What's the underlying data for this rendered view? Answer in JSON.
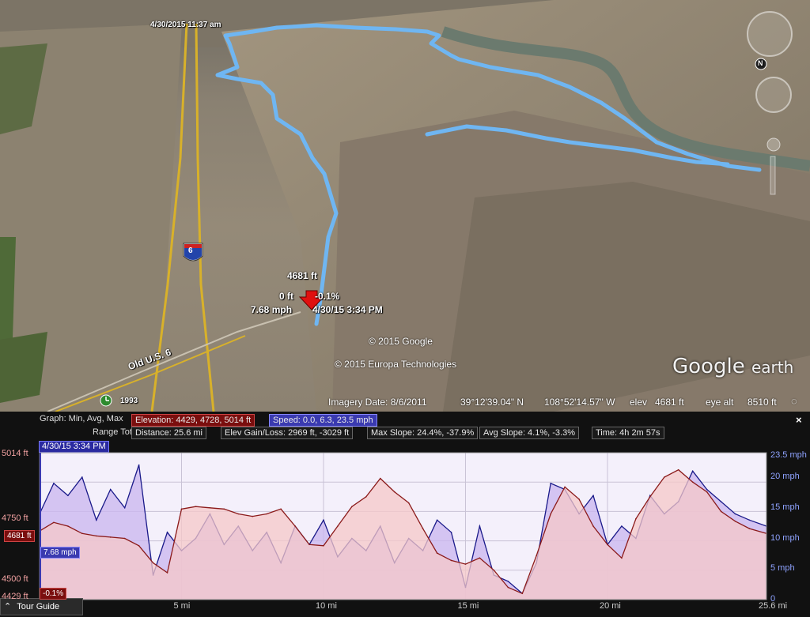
{
  "map": {
    "start_label": "4/30/2015  11:37 am",
    "highway_shield": "6",
    "road_label": "Old U.S. 6",
    "year_label": "1993",
    "cursor": {
      "elevation": "4681 ft",
      "dist": "0 ft",
      "slope": "-0.1%",
      "speed": "7.68 mph",
      "time": "4/30/15 3:34 PM"
    },
    "copyright_google": "© 2015 Google",
    "copyright_europa": "© 2015 Europa Technologies",
    "logo_text": "Google",
    "logo_sub": "earth",
    "compass_label": "N",
    "colors": {
      "track": "#6fb6f2",
      "highway": "#d8b12a",
      "cursor_arrow": "#e01010"
    }
  },
  "status": {
    "imagery_date": "Imagery Date: 8/6/2011",
    "lat": "39°12'39.04\" N",
    "lon": "108°52'14.57\" W",
    "elev_label": "elev",
    "elev": "4681 ft",
    "eye_label": "eye alt",
    "eye": "8510 ft"
  },
  "panel": {
    "graph_label": "Graph: Min, Avg, Max",
    "elevation_stats": "Elevation: 4429, 4728, 5014 ft",
    "speed_stats": "Speed: 0.0, 6.3, 23.5 mph",
    "close_icon": "×",
    "range_label": "Range Totals:",
    "distance": "Distance: 25.6 mi",
    "gain_loss": "Elev Gain/Loss: 2969 ft, -3029 ft",
    "max_slope": "Max Slope: 24.4%, -37.9%",
    "avg_slope": "Avg Slope: 4.1%, -3.3%",
    "time": "Time: 4h 2m 57s",
    "cursor_date": "4/30/15 3:34 PM",
    "tour_guide": "Tour Guide"
  },
  "chart_data": {
    "type": "area",
    "x": [
      0,
      0.5,
      1,
      1.5,
      2,
      2.5,
      3,
      3.5,
      4,
      4.5,
      5,
      5.5,
      6,
      6.5,
      7,
      7.5,
      8,
      8.5,
      9,
      9.5,
      10,
      10.5,
      11,
      11.5,
      12,
      12.5,
      13,
      13.5,
      14,
      14.5,
      15,
      15.5,
      16,
      16.5,
      17,
      17.5,
      18,
      18.5,
      19,
      19.5,
      20,
      20.5,
      21,
      21.5,
      22,
      22.5,
      23,
      23.5,
      24,
      24.5,
      25,
      25.6
    ],
    "xlabel_ticks": [
      {
        "v": 5,
        "label": "5 mi"
      },
      {
        "v": 10,
        "label": "10 mi"
      },
      {
        "v": 15,
        "label": "15 mi"
      },
      {
        "v": 20,
        "label": "20 mi"
      },
      {
        "v": 25.6,
        "label": "25.6 mi"
      }
    ],
    "xlim": [
      0,
      25.6
    ],
    "series": [
      {
        "name": "Elevation",
        "axis": "left",
        "color": "#8b1a1a",
        "fill": "#f6c8c8",
        "ylim": [
          4420,
          5020
        ],
        "yticks": [
          {
            "v": 5014,
            "label": "5014 ft"
          },
          {
            "v": 4750,
            "label": "4750 ft"
          },
          {
            "v": 4500,
            "label": "4500 ft"
          },
          {
            "v": 4429,
            "label": "4429 ft"
          }
        ],
        "values": [
          4700,
          4735,
          4720,
          4690,
          4680,
          4675,
          4670,
          4640,
          4570,
          4530,
          4790,
          4800,
          4795,
          4790,
          4770,
          4760,
          4770,
          4790,
          4720,
          4645,
          4640,
          4720,
          4800,
          4840,
          4915,
          4860,
          4815,
          4710,
          4610,
          4580,
          4565,
          4590,
          4540,
          4470,
          4445,
          4600,
          4770,
          4880,
          4830,
          4720,
          4645,
          4590,
          4750,
          4840,
          4920,
          4950,
          4900,
          4860,
          4780,
          4740,
          4710,
          4690
        ],
        "markers": [
          {
            "v": 4681,
            "label": "4681 ft"
          },
          {
            "v": -0.1,
            "label": "-0.1%"
          }
        ]
      },
      {
        "name": "Speed",
        "axis": "right",
        "color": "#1a1a8a",
        "fill": "#c9b6ef",
        "ylim": [
          0,
          24
        ],
        "yticks": [
          {
            "v": 23.5,
            "label": "23.5 mph"
          },
          {
            "v": 20,
            "label": "20 mph"
          },
          {
            "v": 15,
            "label": "15 mph"
          },
          {
            "v": 10,
            "label": "10 mph"
          },
          {
            "v": 5,
            "label": "5 mph"
          },
          {
            "v": 0,
            "label": "0"
          }
        ],
        "values": [
          14,
          19,
          17,
          20,
          13,
          18,
          15,
          22,
          4,
          11,
          8,
          10,
          14,
          9,
          12,
          8,
          11,
          6,
          12,
          9,
          13,
          7,
          10,
          8,
          12,
          6,
          10,
          8,
          13,
          11,
          2,
          12,
          4,
          3,
          1,
          6,
          19,
          18,
          14,
          17,
          9,
          12,
          10,
          17,
          14,
          16,
          21,
          18,
          16,
          14,
          13,
          12
        ],
        "markers": [
          {
            "v": 7.68,
            "label": "7.68 mph"
          }
        ]
      }
    ]
  }
}
